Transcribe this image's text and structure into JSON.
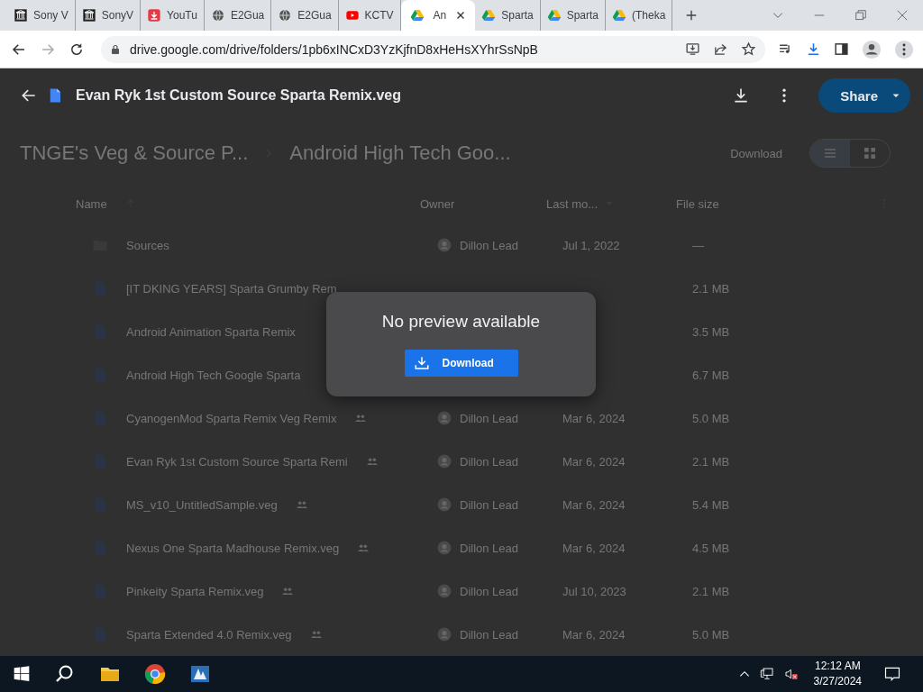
{
  "browser": {
    "tabs": [
      {
        "title": "Sony V",
        "kind": "museum",
        "selected": false
      },
      {
        "title": "SonyV",
        "kind": "museum",
        "selected": false
      },
      {
        "title": "YouTu",
        "kind": "download",
        "selected": false
      },
      {
        "title": "E2Gua",
        "kind": "globe",
        "selected": false
      },
      {
        "title": "E2Gua",
        "kind": "globe",
        "selected": false
      },
      {
        "title": "KCTV",
        "kind": "youtube",
        "selected": false
      },
      {
        "title": "An",
        "kind": "drive",
        "selected": true
      },
      {
        "title": "Sparta",
        "kind": "drive",
        "selected": false
      },
      {
        "title": "Sparta",
        "kind": "drive",
        "selected": false
      },
      {
        "title": "(Theka",
        "kind": "drive",
        "selected": false
      }
    ],
    "url": "drive.google.com/drive/folders/1pb6xINCxD3YzKjfnD8xHeHsXYhrSsNpB"
  },
  "viewer": {
    "file_name": "Evan Ryk 1st Custom Source Sparta Remix.veg",
    "share_label": "Share"
  },
  "drive": {
    "breadcrumbs": [
      "TNGE's Veg & Source P...",
      "Android High Tech Goo..."
    ],
    "toolbar_label": "Download",
    "view_toggle": [
      {
        "kind": "list",
        "selected": true
      },
      {
        "kind": "grid",
        "selected": false
      }
    ],
    "columns": [
      "Name",
      "Owner",
      "Last mo...",
      "File size"
    ],
    "rows": [
      {
        "kind": "folder",
        "name": "Sources",
        "shared": false,
        "owner": "Dillon Lead",
        "modified": "Jul 1, 2022",
        "size": "—"
      },
      {
        "kind": "file",
        "name": "[IT DKING YEARS] Sparta Grumby Rem",
        "shared": false,
        "size": "2.1 MB"
      },
      {
        "kind": "file",
        "name": "Android Animation Sparta Remix",
        "shared": false,
        "size": "3.5 MB"
      },
      {
        "kind": "file",
        "name": "Android High Tech Google Sparta",
        "shared": false,
        "size": "6.7 MB"
      },
      {
        "kind": "file",
        "name": "CyanogenMod Sparta Remix Veg Remix",
        "shared": true,
        "owner": "Dillon Lead",
        "modified": "Mar 6, 2024",
        "size": "5.0 MB"
      },
      {
        "kind": "file",
        "name": "Evan Ryk 1st Custom Source Sparta Remi",
        "shared": true,
        "owner": "Dillon Lead",
        "modified": "Mar 6, 2024",
        "size": "2.1 MB"
      },
      {
        "kind": "file",
        "name": "MS_v10_UntitledSample.veg",
        "shared": true,
        "owner": "Dillon Lead",
        "modified": "Mar 6, 2024",
        "size": "5.4 MB"
      },
      {
        "kind": "file",
        "name": "Nexus One Sparta Madhouse Remix.veg",
        "shared": true,
        "owner": "Dillon Lead",
        "modified": "Mar 6, 2024",
        "size": "4.5 MB"
      },
      {
        "kind": "file",
        "name": "Pinkeity Sparta Remix.veg",
        "shared": true,
        "owner": "Dillon Lead",
        "modified": "Jul 10, 2023",
        "size": "2.1 MB"
      },
      {
        "kind": "file",
        "name": "Sparta Extended 4.0 Remix.veg",
        "shared": true,
        "owner": "Dillon Lead",
        "modified": "Mar 6, 2024",
        "size": "5.0 MB"
      }
    ]
  },
  "dialog": {
    "message": "No preview available",
    "button": "Download"
  },
  "taskbar": {
    "time": "12:12 AM",
    "date": "3/27/2024"
  }
}
